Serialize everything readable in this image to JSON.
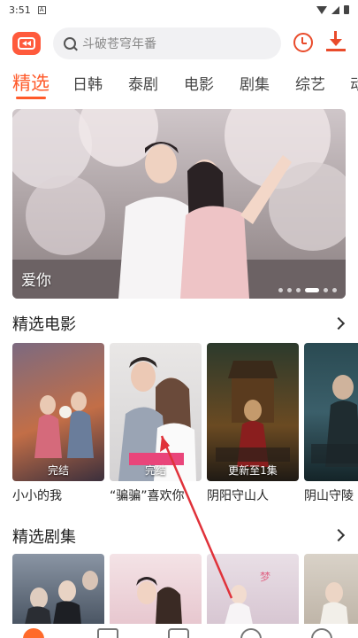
{
  "status": {
    "time": "3:51"
  },
  "search": {
    "placeholder": "斗破苍穹年番"
  },
  "tabs": [
    {
      "label": "精选"
    },
    {
      "label": "日韩"
    },
    {
      "label": "泰剧"
    },
    {
      "label": "电影"
    },
    {
      "label": "剧集"
    },
    {
      "label": "综艺"
    },
    {
      "label": "动"
    }
  ],
  "banner": {
    "title": "爱你"
  },
  "movies": {
    "title": "精选电影",
    "items": [
      {
        "title": "小小的我",
        "badge": "完结"
      },
      {
        "title": "“骗骗”喜欢你",
        "badge": "完结"
      },
      {
        "title": "阴阳守山人",
        "badge": "更新至1集"
      },
      {
        "title": "阴山守陵",
        "badge": ""
      }
    ]
  },
  "series": {
    "title": "精选剧集"
  },
  "colors": {
    "accent": "#ff5a2a",
    "annotation": "#e0323a"
  }
}
